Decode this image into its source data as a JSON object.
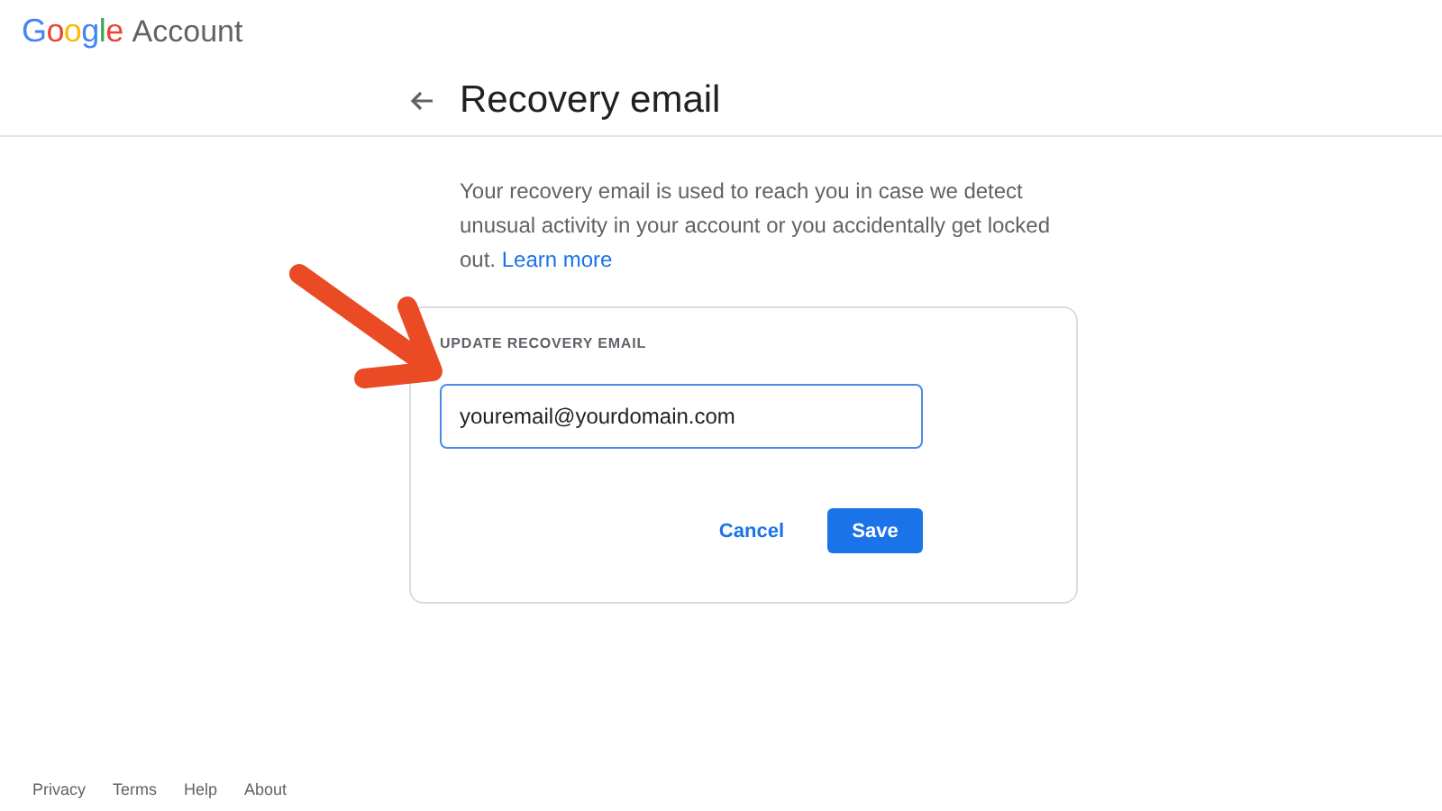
{
  "header": {
    "logo": "Google",
    "product": "Account"
  },
  "page": {
    "title": "Recovery email",
    "description": "Your recovery email is used to reach you in case we detect unusual activity in your account or you accidentally get locked out.",
    "learn_more": "Learn more"
  },
  "card": {
    "label": "UPDATE RECOVERY EMAIL",
    "email": {
      "value": "youremail@yourdomain.com"
    },
    "buttons": [
      {
        "label": "Cancel",
        "kind": "text"
      },
      {
        "label": "Save",
        "kind": "primary"
      }
    ]
  },
  "footer": [
    "Privacy",
    "Terms",
    "Help",
    "About"
  ]
}
